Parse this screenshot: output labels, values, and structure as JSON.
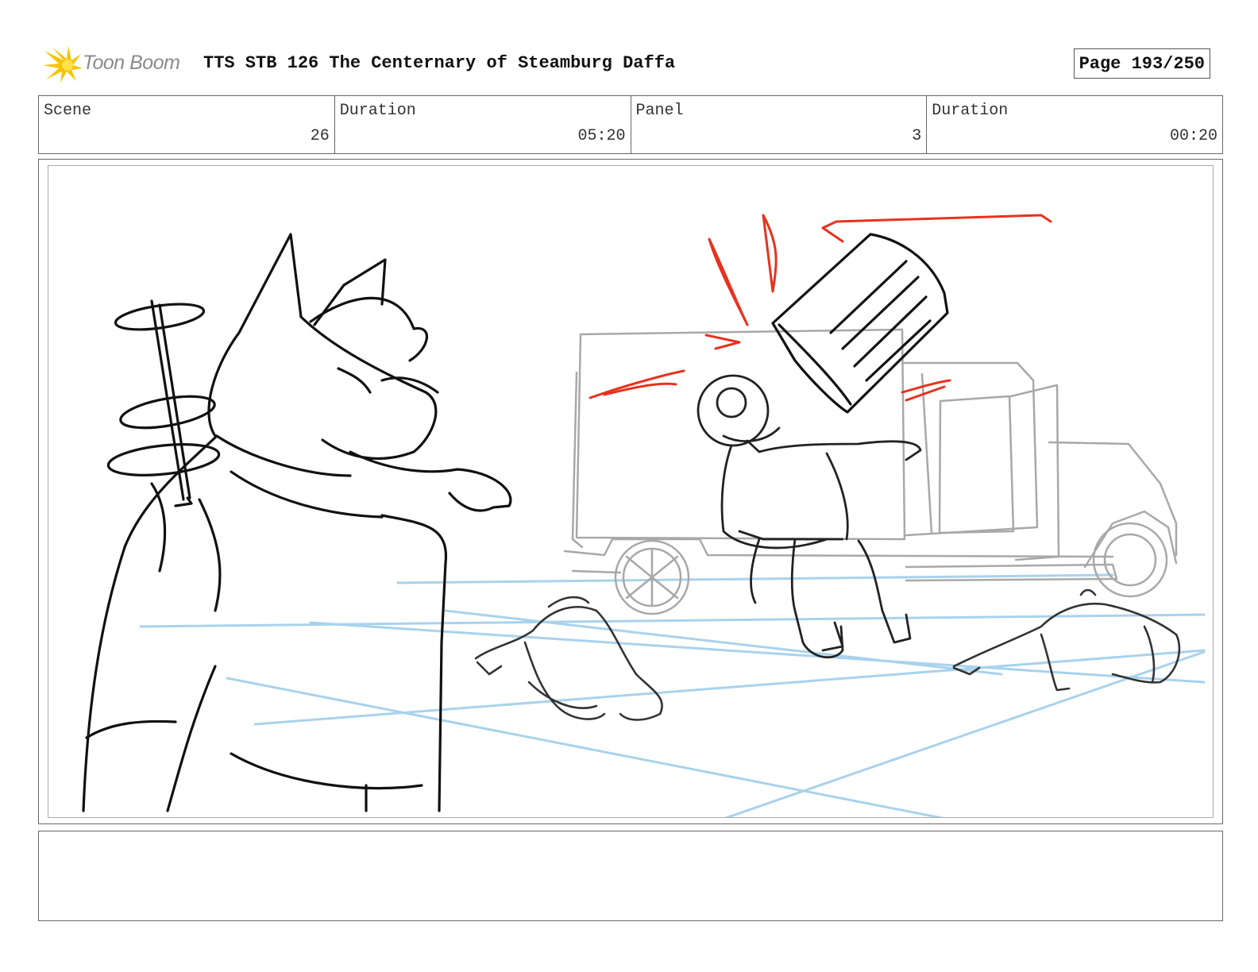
{
  "header": {
    "logo_text": "Toon Boom",
    "title": "TTS STB 126 The Centernary of Steamburg Daffa",
    "page": "Page 193/250"
  },
  "info": {
    "scene_label": "Scene",
    "scene_value": "26",
    "scene_duration_label": "Duration",
    "scene_duration_value": "05:20",
    "panel_label": "Panel",
    "panel_value": "3",
    "panel_duration_label": "Duration",
    "panel_duration_value": "00:20"
  },
  "colors": {
    "ink": "#111111",
    "truck_gray": "#a8a8a8",
    "ground_blue": "#a9d2ec",
    "action_red": "#e8321e",
    "logo_yellow": "#f5c400"
  },
  "icons": {
    "logo": "toon-boom-starburst-icon"
  },
  "notes": ""
}
